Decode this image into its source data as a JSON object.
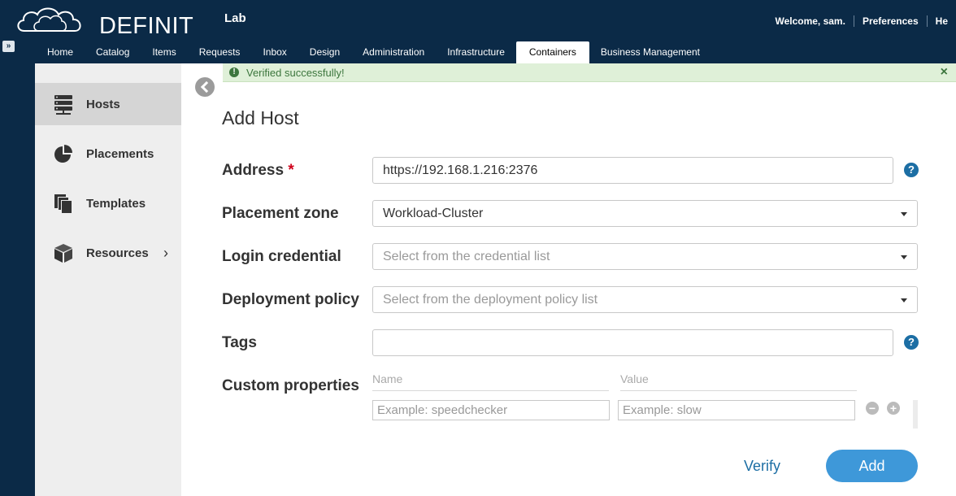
{
  "app": {
    "brand": "DEFINIT",
    "tenant": "Lab"
  },
  "user_links": [
    "Welcome, sam.",
    "Preferences",
    "He"
  ],
  "nav": {
    "tabs": [
      "Home",
      "Catalog",
      "Items",
      "Requests",
      "Inbox",
      "Design",
      "Administration",
      "Infrastructure",
      "Containers",
      "Business Management"
    ],
    "active": "Containers"
  },
  "sidebar": {
    "items": [
      {
        "label": "Hosts",
        "icon": "server-icon",
        "active": true
      },
      {
        "label": "Placements",
        "icon": "pie-chart-icon"
      },
      {
        "label": "Templates",
        "icon": "copy-icon"
      },
      {
        "label": "Resources",
        "icon": "cube-icon",
        "chevron": "›"
      }
    ]
  },
  "alert": {
    "text": "Verified successfully!",
    "icon": "!",
    "close": "×"
  },
  "form": {
    "title": "Add Host",
    "address": {
      "label": "Address",
      "required_mark": "*",
      "value": "https://192.168.1.216:2376"
    },
    "placement_zone": {
      "label": "Placement zone",
      "value": "Workload-Cluster"
    },
    "login_credential": {
      "label": "Login credential",
      "placeholder": "Select from the credential list"
    },
    "deployment_policy": {
      "label": "Deployment policy",
      "placeholder": "Select from the deployment policy list"
    },
    "tags": {
      "label": "Tags",
      "value": ""
    },
    "custom_properties": {
      "label": "Custom properties",
      "name_header": "Name",
      "value_header": "Value",
      "name_placeholder": "Example: speedchecker",
      "value_placeholder": "Example: slow",
      "remove_symbol": "−",
      "add_symbol": "+"
    },
    "help_symbol": "?",
    "verify_label": "Verify",
    "add_label": "Add"
  },
  "colors": {
    "header_bg": "#0b2a47",
    "sidebar_bg": "#eeeeee",
    "alert_bg": "#dff0d8",
    "accent": "#3e98d9",
    "link": "#1c6ea4",
    "required": "#d0021b"
  }
}
